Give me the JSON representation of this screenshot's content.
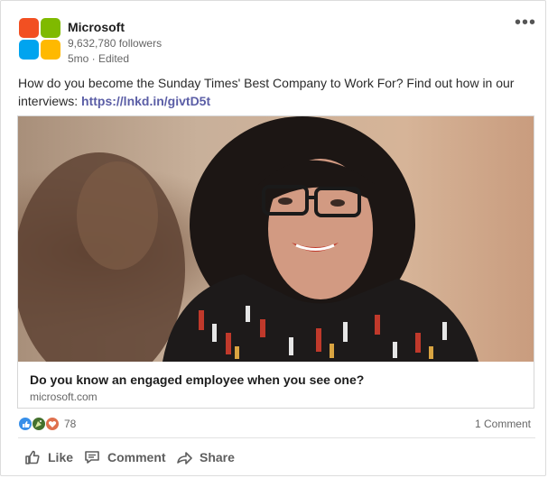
{
  "company": {
    "name": "Microsoft",
    "followers": "9,632,780 followers",
    "meta": "5mo · Edited",
    "logo_colors": [
      "#f25022",
      "#7fba00",
      "#00a4ef",
      "#ffb900"
    ]
  },
  "post": {
    "text": "How do you become the Sunday Times' Best Company to Work For? Find out how in our interviews: ",
    "link": "https://lnkd.in/givtD5t"
  },
  "article": {
    "title": "Do you know an engaged employee when you see one?",
    "source": "microsoft.com",
    "image": "photo-of-smiling-woman-with-glasses"
  },
  "social": {
    "reaction_icons": [
      "like-icon",
      "celebrate-icon",
      "love-icon"
    ],
    "reaction_count": "78",
    "comment_count": "1 Comment"
  },
  "actions": {
    "like": "Like",
    "comment": "Comment",
    "share": "Share"
  },
  "menu": {
    "more_glyph": "•••"
  }
}
